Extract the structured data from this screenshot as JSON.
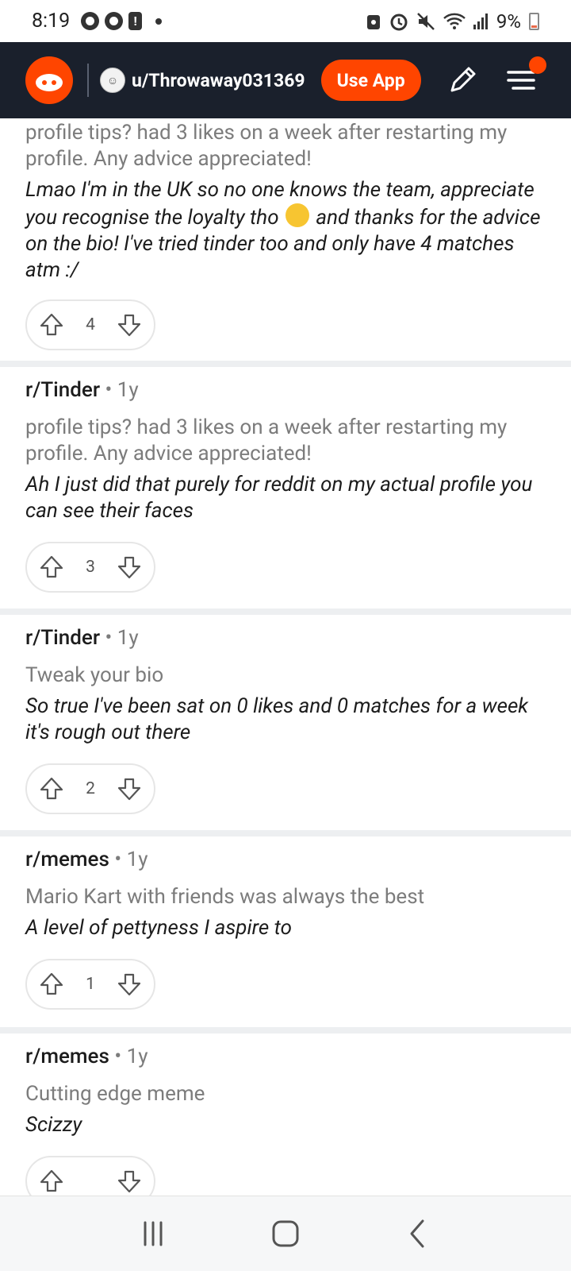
{
  "status_bar": {
    "time": "8:19",
    "battery": "9%"
  },
  "header": {
    "username": "u/Throwaway031369",
    "use_app_label": "Use App"
  },
  "colors": {
    "accent": "#ff4500",
    "header_bg": "#1a202c"
  },
  "comments": [
    {
      "subreddit": "",
      "age": "",
      "post_title": "profile tips? had 3 likes on a week after restarting my profile. Any advice appreciated!",
      "body_before_emoji": "Lmao I'm in the UK so no one knows the team, appreciate you recognise the loyalty tho",
      "body_after_emoji": "and thanks for the advice on the bio! I've tried tinder too and only have 4 matches atm :/",
      "votes": "4"
    },
    {
      "subreddit": "r/Tinder",
      "age": "1y",
      "post_title": "profile tips? had 3 likes on a week after restarting my profile. Any advice appreciated!",
      "body": "Ah I just did that purely for reddit on my actual profile you can see their faces",
      "votes": "3"
    },
    {
      "subreddit": "r/Tinder",
      "age": "1y",
      "post_title": "Tweak your bio",
      "body": "So true I've been sat on 0 likes and 0 matches for a week it's rough out there",
      "votes": "2"
    },
    {
      "subreddit": "r/memes",
      "age": "1y",
      "post_title": "Mario Kart with friends was always the best",
      "body": "A level of pettyness I aspire to",
      "votes": "1"
    },
    {
      "subreddit": "r/memes",
      "age": "1y",
      "post_title": "Cutting edge meme",
      "body": "Scizzy",
      "votes": ""
    }
  ],
  "separator": "•",
  "icons": {
    "upvote": "arrow-up-outline-icon",
    "downvote": "arrow-down-outline-icon",
    "emoji": "laughing-tears-emoji-icon",
    "logo": "reddit-logo-icon",
    "edit": "pencil-icon",
    "menu": "hamburger-menu-icon"
  }
}
